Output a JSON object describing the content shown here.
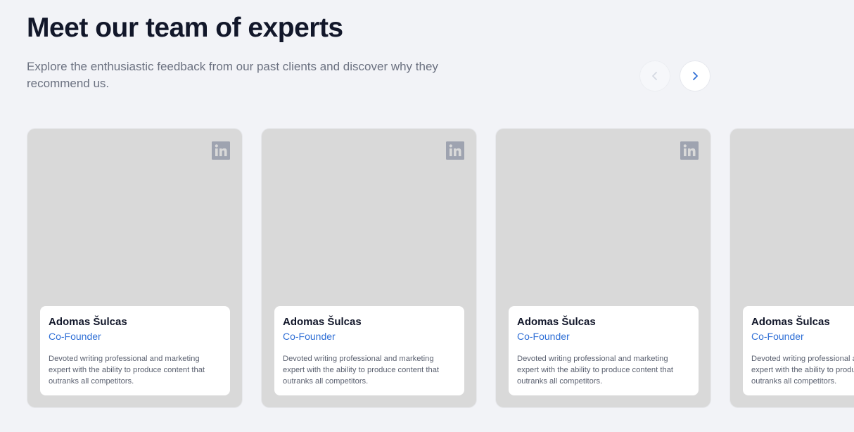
{
  "header": {
    "title": "Meet our team of experts",
    "subtitle": "Explore the enthusiastic feedback from our past clients and discover why they recommend us."
  },
  "nav": {
    "prev_icon": "chevron-left-icon",
    "next_icon": "chevron-right-icon",
    "accent": "#2f6fd6",
    "disabled_color": "#d5d9e2"
  },
  "team": [
    {
      "name": "Adomas Šulcas",
      "role": "Co-Founder",
      "description": "Devoted writing professional and marketing expert with the ability to produce content that outranks all competitors.",
      "social_icon": "linkedin-icon"
    },
    {
      "name": "Adomas Šulcas",
      "role": "Co-Founder",
      "description": "Devoted writing professional and marketing expert with the ability to produce content that outranks all competitors.",
      "social_icon": "linkedin-icon"
    },
    {
      "name": "Adomas Šulcas",
      "role": "Co-Founder",
      "description": "Devoted writing professional and marketing expert with the ability to produce content that outranks all competitors.",
      "social_icon": "linkedin-icon"
    },
    {
      "name": "Adomas Šulcas",
      "role": "Co-Founder",
      "description": "Devoted writing professional and marketing expert with the ability to produce content that outranks all competitors.",
      "social_icon": "linkedin-icon"
    }
  ],
  "colors": {
    "background": "#f2f3f7",
    "card_placeholder": "#d9d9d9",
    "linkedin_icon": "#9ea3b0",
    "role_text": "#2f6fd6"
  }
}
